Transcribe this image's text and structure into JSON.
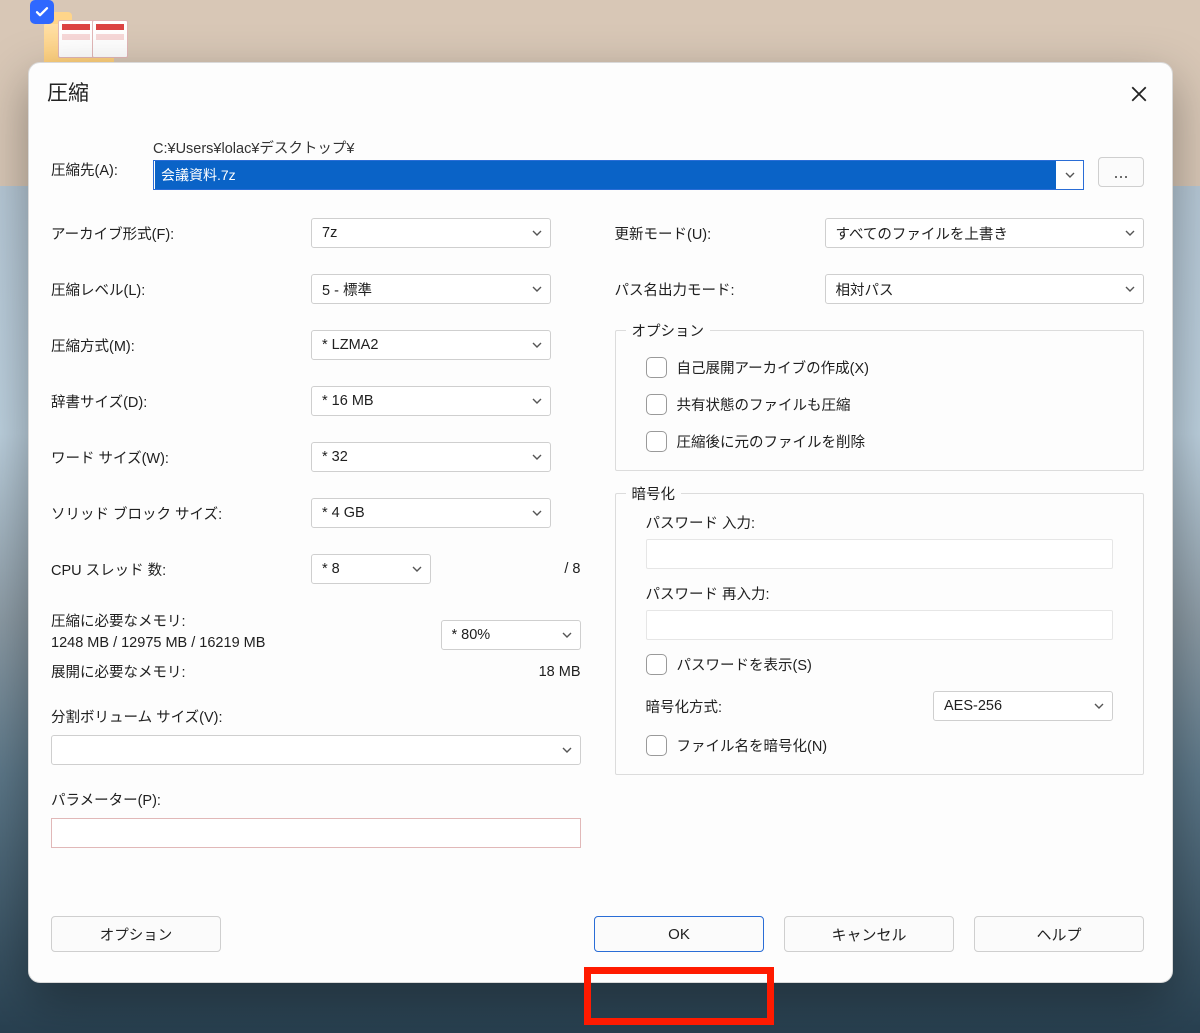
{
  "dialog": {
    "title": "圧縮",
    "dest": {
      "label": "圧縮先(A):",
      "path": "C:¥Users¥lolac¥デスクトップ¥",
      "filename": "会議資料.7z",
      "browse_glyph": "..."
    },
    "left": {
      "format": {
        "label": "アーカイブ形式(F):",
        "value": "7z"
      },
      "level": {
        "label": "圧縮レベル(L):",
        "value": "5 - 標準"
      },
      "method": {
        "label": "圧縮方式(M):",
        "value": "*  LZMA2"
      },
      "dict": {
        "label": "辞書サイズ(D):",
        "value": "*  16 MB"
      },
      "word": {
        "label": "ワード サイズ(W):",
        "value": "*  32"
      },
      "solid": {
        "label": "ソリッド ブロック サイズ:",
        "value": "*  4 GB"
      },
      "threads": {
        "label": "CPU スレッド 数:",
        "value": "*  8",
        "total": "/ 8"
      },
      "mem_compress": {
        "label": "圧縮に必要なメモリ:",
        "detail": "1248 MB / 12975 MB / 16219 MB",
        "pct": "*  80%"
      },
      "mem_decompress": {
        "label": "展開に必要なメモリ:",
        "value": "18 MB"
      },
      "split": {
        "label": "分割ボリューム サイズ(V):",
        "value": ""
      },
      "params": {
        "label": "パラメーター(P):",
        "value": ""
      }
    },
    "right": {
      "update_mode": {
        "label": "更新モード(U):",
        "value": "すべてのファイルを上書き"
      },
      "path_mode": {
        "label": "パス名出力モード:",
        "value": "相対パス"
      },
      "options_group": {
        "legend": "オプション",
        "sfx": "自己展開アーカイブの作成(X)",
        "shared": "共有状態のファイルも圧縮",
        "delete_after": "圧縮後に元のファイルを削除"
      },
      "enc_group": {
        "legend": "暗号化",
        "pw_label": "パスワード 入力:",
        "pw2_label": "パスワード 再入力:",
        "show_pw": "パスワードを表示(S)",
        "method_label": "暗号化方式:",
        "method_value": "AES-256",
        "encrypt_names": "ファイル名を暗号化(N)"
      }
    },
    "footer": {
      "options": "オプション",
      "ok": "OK",
      "cancel": "キャンセル",
      "help": "ヘルプ"
    }
  }
}
